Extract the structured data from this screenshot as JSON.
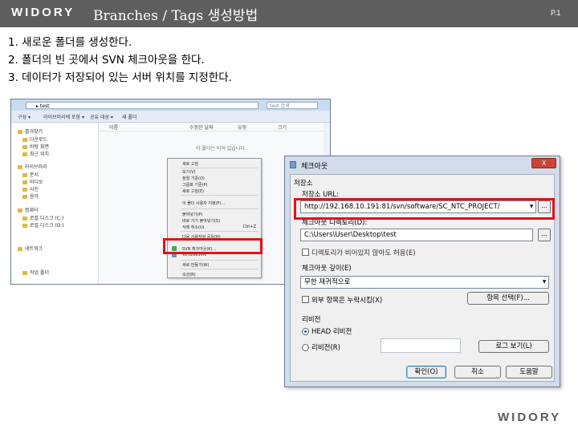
{
  "header": {
    "logo": "WIDORY",
    "title": "Branches / Tags 생성방법",
    "page": "P.1"
  },
  "steps": [
    "1.  새로운 폴더를 생성한다.",
    "2.  폴더의 빈 곳에서 SVN 체크아웃을 한다.",
    "3.  데이터가 저장되어 있는 서버 위치를 지정한다."
  ],
  "explorer": {
    "address": "▸ test",
    "search": "test 검색",
    "toolbar": [
      "구성 ▾",
      "라이브러리에 포함 ▾",
      "공유 대상 ▾",
      "새 폴더"
    ],
    "nav": [
      "즐겨찾기",
      "다운로드",
      "바탕 화면",
      "최근 위치",
      "라이브러리",
      "문서",
      "비디오",
      "사진",
      "음악",
      "컴퓨터",
      "로컬 디스크 (C:)",
      "로컬 디스크 (D:)",
      "네트워크",
      "작업 폴더"
    ],
    "columns": [
      "이름",
      "수정한 날짜",
      "유형",
      "크기"
    ],
    "empty_text": "이 폴더는 비어 있습니다."
  },
  "context_menu": {
    "items": [
      {
        "label": "새로 고침",
        "key": ""
      },
      {
        "label": "보기(V)",
        "key": ""
      },
      {
        "label": "정렬 기준(O)",
        "key": ""
      },
      {
        "label": "그룹화 기준(P)",
        "key": ""
      },
      {
        "label": "새로 고침(E)",
        "key": ""
      },
      {
        "label": "이 폴더 사용자 지정(F)...",
        "key": ""
      },
      {
        "label": "붙여넣기(P)",
        "key": ""
      },
      {
        "label": "바로 가기 붙여넣기(S)",
        "key": ""
      },
      {
        "label": "삭제 취소(U)",
        "key": "Ctrl+Z"
      },
      {
        "label": "다음 사용자와 공유(H)",
        "key": ""
      },
      {
        "label": "SVN 체크아웃(K)...",
        "key": ""
      },
      {
        "label": "TortoiseSVN",
        "key": ""
      },
      {
        "label": "새로 만들기(W)",
        "key": ""
      },
      {
        "label": "속성(R)",
        "key": ""
      }
    ]
  },
  "dialog": {
    "title": "체크아웃",
    "close": "X",
    "group_repo": "저장소",
    "url_label": "저장소 URL:",
    "url_value": "http://192.168.10.191:81/svn/software/SC_NTC_PROJECT/",
    "dir_label": "체크아웃 디렉토리(D):",
    "dir_value": "C:\\Users\\User\\Desktop\\test",
    "empty_ok": "디렉토리가 비어있지 않아도 허용(E)",
    "depth_group": "체크아웃 깊이(E)",
    "depth_value": "무한 재귀적으로",
    "exclude_externals": "외부 항목은 누락시킴(X)",
    "select_items": "항목 선택(F)...",
    "revision_group": "리비전",
    "head_label": "HEAD 리비전",
    "revision_label": "리비전(R)",
    "show_log": "로그 보기(L)",
    "ok": "확인(O)",
    "cancel": "취소",
    "help": "도움말",
    "ellipsis": "..."
  },
  "footer": {
    "logo": "WIDORY"
  },
  "colors": {
    "header_bg": "#5e5e5e",
    "highlight": "#e2121b",
    "dialog_bg": "#f0f0f0"
  }
}
